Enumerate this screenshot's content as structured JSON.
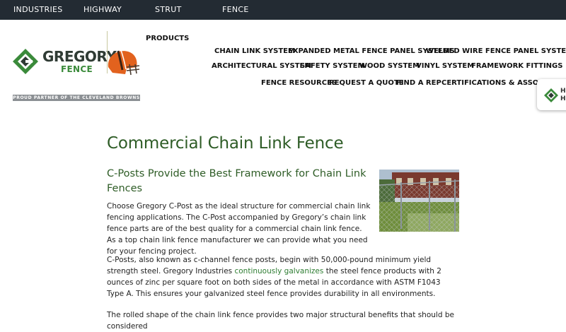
{
  "topbar": {
    "items": [
      "INDUSTRIES",
      "HIGHWAY",
      "STRUT",
      "FENCE"
    ]
  },
  "brand": {
    "name": "GREGORY",
    "sub": "FENCE",
    "partner_text": "PROUD PARTNER OF THE CLEVELAND BROWNS",
    "accent_color": "#3a8a3a",
    "dark_color": "#2f3b34"
  },
  "nav": {
    "products": "PRODUCTS",
    "row1": [
      "CHAIN LINK SYSTEM",
      "EXPANDED METAL FENCE PANEL SYSTEMS",
      "WELDED WIRE FENCE PANEL SYSTEMS"
    ],
    "row2": [
      "ARCHITECTURAL SYSTEM",
      "SAFETY SYSTEM",
      "WOOD SYSTEM",
      "VINYL SYSTEM",
      "FRAMEWORK FITTINGS"
    ],
    "row3": [
      "FENCE RESOURCES",
      "REQUEST A QUOTE",
      "FIND A REP",
      "CERTIFICATIONS & ASSOCIAT"
    ]
  },
  "widget": {
    "line1": "H",
    "line2": "H",
    "icon": "gregory-logo-icon"
  },
  "content": {
    "title": "Commercial Chain Link Fence",
    "subtitle": "C-Posts Provide the Best Framework for Chain Link Fences",
    "p1": "Choose Gregory C-Post as the ideal structure for commercial chain link fencing applications. The C-Post accompanied by Gregory’s chain link fence parts are of the best quality for a commercial chain link fence. As a top chain link fence manufacturer we can provide what you need for your fencing project.",
    "p2_before": "C-Posts, also known as c-channel fence posts, begin with 50,000-pound minimum yield strength steel. Gregory Industries ",
    "p2_link": "continuously galvanizes",
    "p2_after": " the steel fence products with 2 ounces of zinc per square foot on both sides of the metal in accordance with ASTM F1043 Type A. This ensures your galvanized steel fence provides durability in all environments.",
    "p3": "The rolled shape of the chain link fence provides two major structural benefits that should be considered",
    "link_color": "#2e7d32",
    "heading_color": "#2e5c26"
  }
}
